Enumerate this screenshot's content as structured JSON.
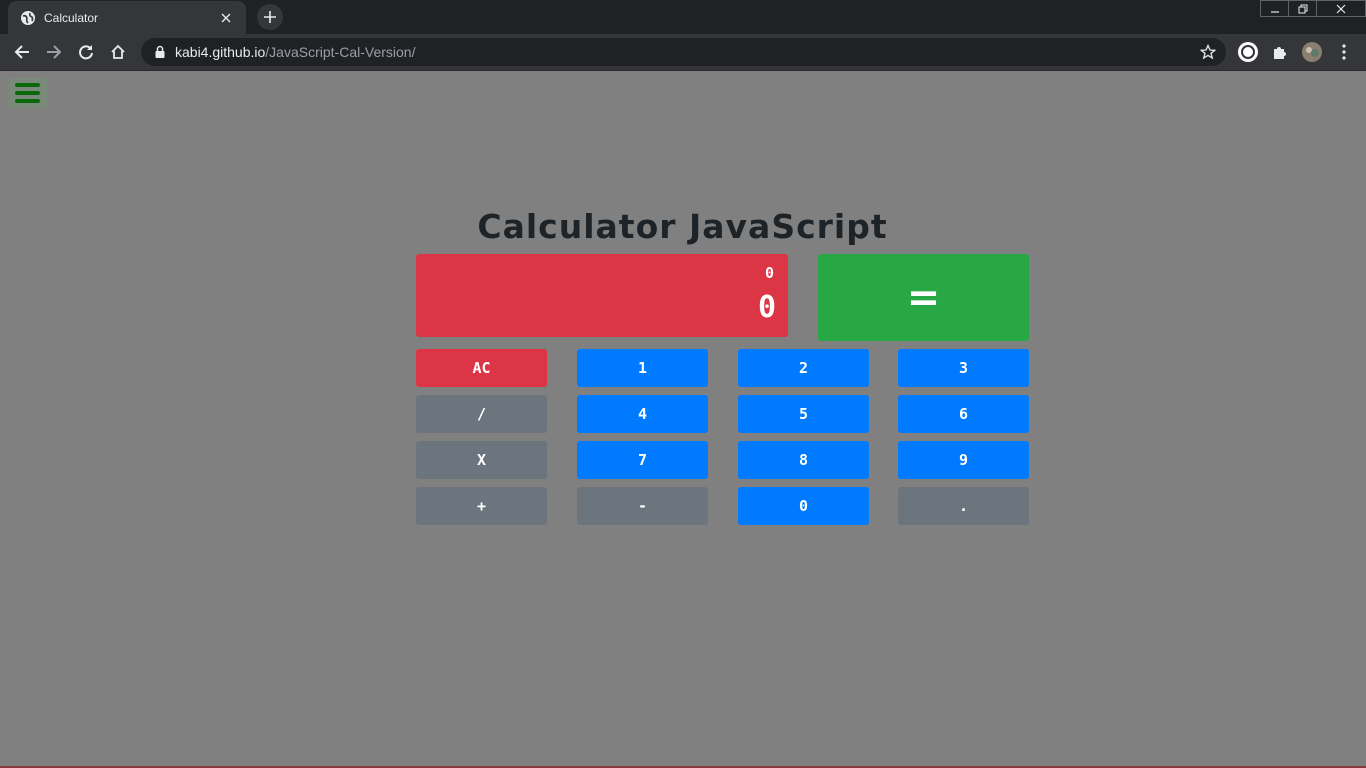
{
  "browser": {
    "tab_title": "Calculator",
    "url_host": "kabi4.github.io",
    "url_path": "/JavaScript-Cal-Version/"
  },
  "page": {
    "title": "Calculator JavaScript",
    "menu_icon": "hamburger-icon"
  },
  "calculator": {
    "previous_operand": "0",
    "current_operand": "0",
    "equals_label": "=",
    "keys": [
      [
        "AC",
        "1",
        "2",
        "3"
      ],
      [
        "/",
        "4",
        "5",
        "6"
      ],
      [
        "X",
        "7",
        "8",
        "9"
      ],
      [
        "+",
        "-",
        "0",
        "."
      ]
    ]
  },
  "colors": {
    "page_bg": "#808080",
    "display": "#dc3545",
    "equals": "#28a745",
    "digit": "#007bff",
    "operator": "#6c757d",
    "clear": "#dc3545"
  }
}
